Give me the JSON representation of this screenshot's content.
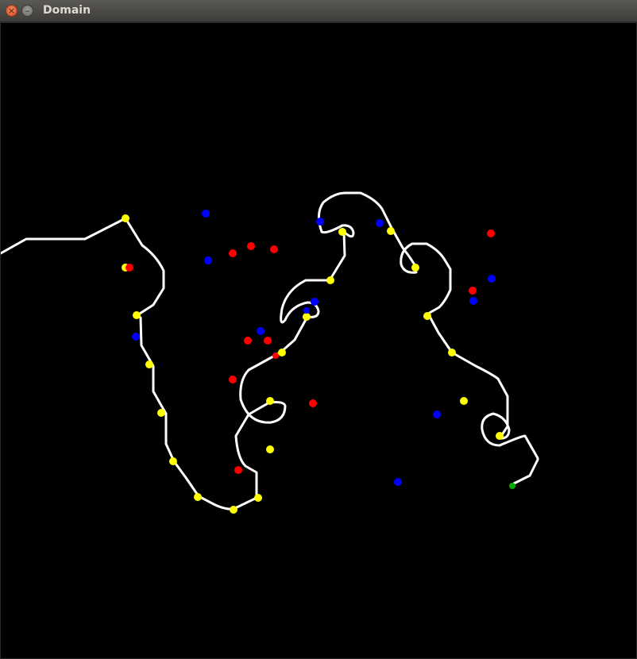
{
  "window": {
    "title": "Domain",
    "close_glyph": "×",
    "minimize_glyph": "–"
  },
  "colors": {
    "background": "#000000",
    "path": "#ffffff",
    "waypoint": "#ffff00",
    "red_marker": "#ff0000",
    "blue_marker": "#0000ff",
    "end_marker": "#00aa00"
  }
}
